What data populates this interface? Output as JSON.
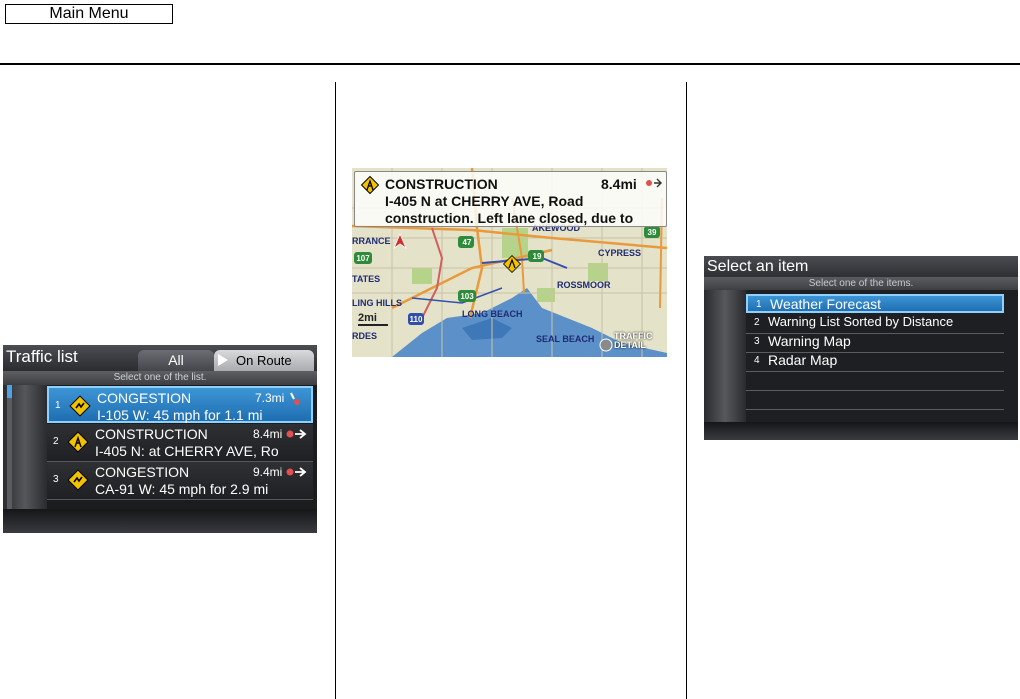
{
  "header": {
    "main_menu_label": "Main Menu"
  },
  "traffic_list": {
    "title": "Traffic list",
    "tabs": [
      {
        "label": "All"
      },
      {
        "label": "On Route"
      }
    ],
    "subtitle": "Select one of the list.",
    "items": [
      {
        "num": "1",
        "type": "CONGESTION",
        "dist": "7.3mi",
        "desc": "I-105 W: 45 mph for 1.1 mi",
        "icon": "congestion-icon"
      },
      {
        "num": "2",
        "type": "CONSTRUCTION",
        "dist": "8.4mi",
        "desc": "I-405 N: at CHERRY AVE, Ro",
        "icon": "construction-icon"
      },
      {
        "num": "3",
        "type": "CONGESTION",
        "dist": "9.4mi",
        "desc": "CA-91 W: 45 mph for 2.9 mi",
        "icon": "congestion-icon"
      }
    ]
  },
  "map": {
    "popup": {
      "type": "CONSTRUCTION",
      "dist": "8.4mi",
      "line1": "I-405 N at CHERRY AVE, Road",
      "line2": "construction. Left lane closed, due to",
      "icon": "construction-icon"
    },
    "labels": {
      "lakewood": "AKEWOOD",
      "torrance": "RRANCE",
      "cypress": "CYPRESS",
      "states": "TATES",
      "rossmoor": "ROSSMOOR",
      "rolling_hills": "LING HILLS",
      "long_beach": "LONG BEACH",
      "seal_beach": "SEAL BEACH",
      "rdes": "RDES"
    },
    "shields": {
      "s47": "47",
      "s19": "19",
      "s107": "107",
      "s103": "103",
      "s110": "110",
      "s39": "39"
    },
    "scale": "2mi",
    "traffic_detail": [
      "TRAFFIC",
      "DETAIL"
    ]
  },
  "select_item": {
    "title": "Select an item",
    "subtitle": "Select one of the items.",
    "items": [
      {
        "num": "1",
        "label": "Weather Forecast"
      },
      {
        "num": "2",
        "label": "Warning List Sorted by Distance"
      },
      {
        "num": "3",
        "label": "Warning Map"
      },
      {
        "num": "4",
        "label": "Radar Map"
      }
    ]
  }
}
